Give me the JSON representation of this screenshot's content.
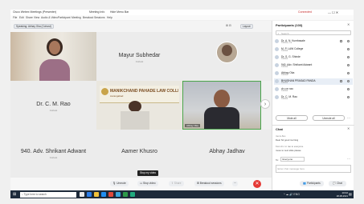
{
  "window": {
    "tab1": "Cisco Webex Meetings (Presenter)",
    "tab2": "Meeting Info",
    "tab3": "Hide Menu Bar",
    "status": "Connected"
  },
  "menu": [
    "File",
    "Edit",
    "Share",
    "View",
    "Audio & Video",
    "Participant",
    "Meeting",
    "Breakout Sessions",
    "Help"
  ],
  "topbar": {
    "speaking": "Speaking: Abhay Oka (Cohost)",
    "layout": "Layout"
  },
  "tiles": [
    {
      "name": "Mayur Subhedar",
      "sub": "Cohost"
    },
    {
      "name": "Dr. C. M. Rao",
      "sub": "Cohost"
    },
    {
      "name": "MANIKCHAND PAHADE LAW COLLEGE",
      "sub": "Aurangabad"
    },
    {
      "name": "Abhay Oka",
      "sub": ""
    },
    {
      "name": "940. Adv. Shrikant Adwant",
      "sub": "Cohost"
    },
    {
      "name": "Aamer Khusro",
      "sub": ""
    },
    {
      "name": "Abhay Jadhav",
      "sub": ""
    }
  ],
  "panel": {
    "title": "Participants (103)",
    "search_placeholder": "Search",
    "participants": [
      {
        "name": "Dr. A. N. Kumbasale",
        "sub": "Cohost, me"
      },
      {
        "name": "M. P. LAW College",
        "sub": "Cohost"
      },
      {
        "name": "Dr. S. G. Shinde",
        "sub": "Cohost"
      },
      {
        "name": "940. Adv. Shrikant Adwant",
        "sub": "Cohost"
      },
      {
        "name": "Abhay Oka",
        "sub": "Cohost"
      },
      {
        "name": "BHUSHAN PRASAD PANDA",
        "sub": "Cohost"
      },
      {
        "name": "dr c m rao",
        "sub": "Cohost"
      },
      {
        "name": "Dr. C. M. Rao",
        "sub": "Cohost"
      }
    ],
    "mute_all": "Mute all",
    "unmute_all": "Unmute all",
    "chat_title": "Chat",
    "chat": [
      "me to ALL",
      "Dear Sir good morning",
      "from dr c m rao to everyone",
      "move to next slide please"
    ],
    "to_label": "To:",
    "to_value": "Everyone",
    "chat_placeholder": "Enter chat message here"
  },
  "toolbar": {
    "tooltip": "Stop my video",
    "unmute": "Unmute",
    "stop_video": "Stop video",
    "share": "Share",
    "breakout": "Breakout sessions",
    "participants": "Participants",
    "chat": "Chat"
  },
  "taskbar": {
    "search_placeholder": "Type here to search",
    "time": "10:02",
    "date": "28-08-2021"
  },
  "colors": {
    "end_button": "#e53935",
    "active_border": "#4aa54a",
    "taskbar": "#1d2a3a"
  }
}
